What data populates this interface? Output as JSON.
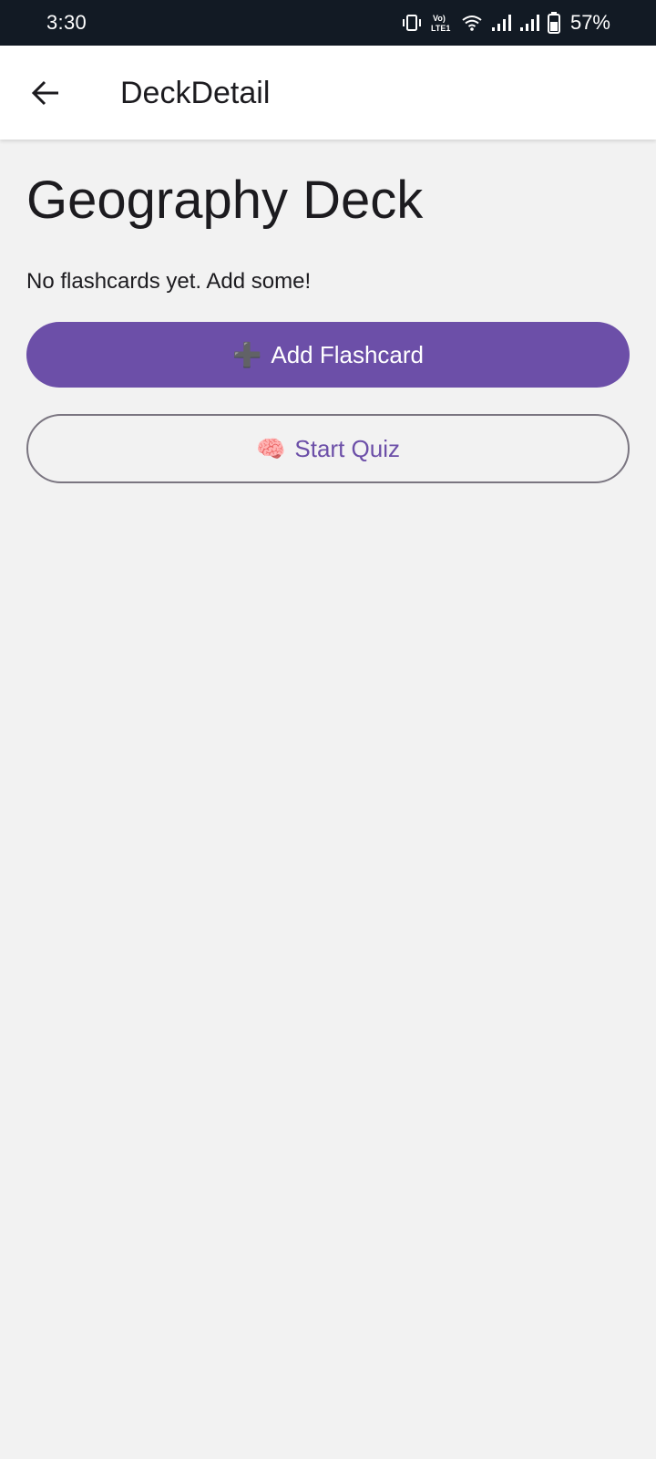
{
  "status_bar": {
    "time": "3:30",
    "network_label": "Vo) LTE1",
    "battery_percent": "57%",
    "icons": [
      "vibrate-icon",
      "volte-icon",
      "wifi-icon",
      "signal-icon",
      "signal-icon",
      "battery-icon"
    ]
  },
  "app_bar": {
    "title": "DeckDetail",
    "back_icon": "arrow-left-icon"
  },
  "deck": {
    "title": "Geography Deck",
    "empty_message": "No flashcards yet. Add some!"
  },
  "actions": {
    "add_icon": "➕",
    "add_label": "Add Flashcard",
    "quiz_icon": "🧠",
    "quiz_label": "Start Quiz"
  },
  "colors": {
    "primary": "#6c4fa8",
    "status_bar_bg": "#121a24",
    "background": "#f2f2f2",
    "outline": "#7a7580"
  }
}
